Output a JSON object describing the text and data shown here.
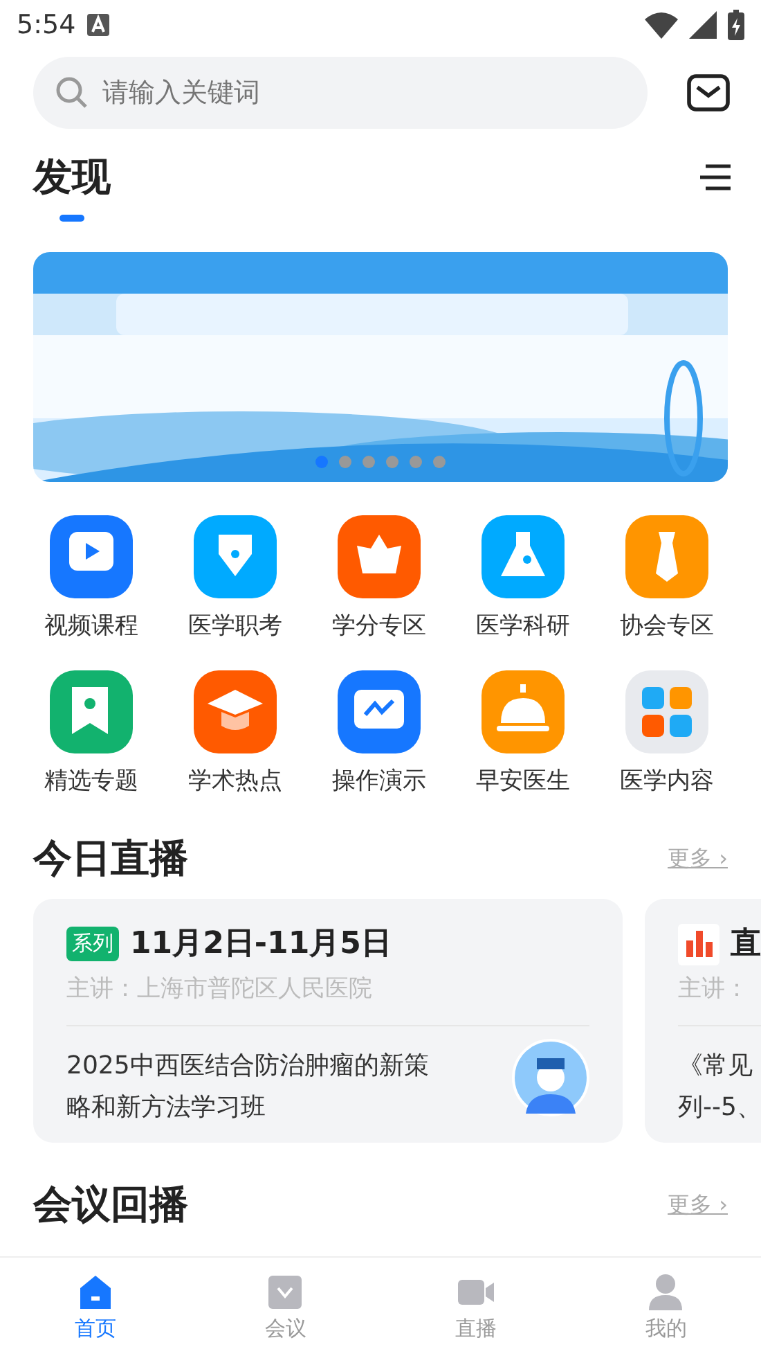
{
  "status_bar": {
    "time": "5:54"
  },
  "search": {
    "placeholder": "请输入关键词"
  },
  "header": {
    "title": "发现"
  },
  "banner": {
    "kind": "picture",
    "dots": [
      {
        "selected": true
      },
      {
        "selected": false
      },
      {
        "selected": false
      },
      {
        "selected": false
      },
      {
        "selected": false
      },
      {
        "selected": false
      }
    ]
  },
  "categories": [
    {
      "label": "视频课程",
      "color": "#1677ff",
      "kind": "video"
    },
    {
      "label": "医学职考",
      "color": "#00aaff",
      "kind": "pen"
    },
    {
      "label": "学分专区",
      "color": "#ff5a00",
      "kind": "ingot"
    },
    {
      "label": "医学科研",
      "color": "#00aaff",
      "kind": "flask"
    },
    {
      "label": "协会专区",
      "color": "#ff9500",
      "kind": "tie"
    },
    {
      "label": "精选专题",
      "color": "#12b26e",
      "kind": "bookmark"
    },
    {
      "label": "学术热点",
      "color": "#ff5a00",
      "kind": "cap"
    },
    {
      "label": "操作演示",
      "color": "#1677ff",
      "kind": "screen"
    },
    {
      "label": "早安医生",
      "color": "#ff9500",
      "kind": "bell"
    },
    {
      "label": "医学内容",
      "color": "#e8eaee",
      "kind": "grid"
    }
  ],
  "live": {
    "title": "今日直播",
    "more": "更多 ›",
    "cards": [
      {
        "tag": "系列",
        "title": "11月2日-11月5日",
        "speaker": "主讲：上海市普陀区人民医院",
        "lines": [
          "2025中西医结合防治肿瘤的新策",
          "略和新方法学习班"
        ],
        "kind": "series"
      },
      {
        "title": "直",
        "speaker": "主讲：",
        "lines": [
          "《常见",
          "列--5、"
        ],
        "kind": "live"
      }
    ]
  },
  "replay": {
    "title": "会议回播",
    "more": "更多 ›"
  },
  "tabs": [
    {
      "label": "首页",
      "selected": true,
      "kind": "home"
    },
    {
      "label": "会议",
      "selected": false,
      "kind": "meeting"
    },
    {
      "label": "直播",
      "selected": false,
      "kind": "camera"
    },
    {
      "label": "我的",
      "selected": false,
      "kind": "user"
    }
  ]
}
